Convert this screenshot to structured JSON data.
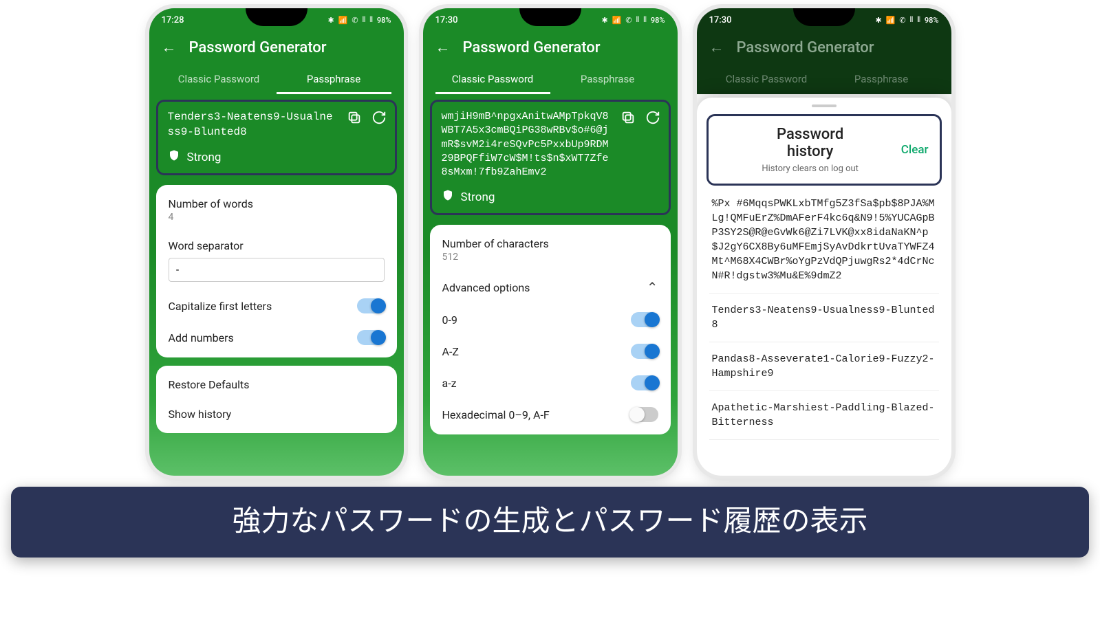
{
  "status": {
    "time1": "17:28",
    "time2": "17:30",
    "time3": "17:30",
    "battery": "98%",
    "icons": "✱ ✉ ⋯   ✱ 📶 ✆ 🔇 ⫴ ⫴"
  },
  "pageTitle": "Password Generator",
  "tabs": {
    "classic": "Classic Password",
    "passphrase": "Passphrase"
  },
  "phone1": {
    "output": "Tenders3-Neatens9-Usualness9-Blunted8",
    "strength": "Strong",
    "numWordsLabel": "Number of words",
    "numWordsValue": "4",
    "separatorLabel": "Word separator",
    "separatorValue": "-",
    "capLabel": "Capitalize first letters",
    "addNumLabel": "Add numbers",
    "restoreLabel": "Restore Defaults",
    "historyLabel": "Show history"
  },
  "phone2": {
    "output": "wmjiH9mB^npgxAnitwAMpTpkqV8WBT7A5x3cmBQiPG38wRBv$o#6@jmR$svM2i4reSQvPc5PxxbUp9RDM29BPQFfiW7cW$M!ts$n$xWT7Zfe8sMxm!7fb9ZahEmv2",
    "strength": "Strong",
    "numCharsLabel": "Number of characters",
    "numCharsValue": "512",
    "advLabel": "Advanced options",
    "opt1": "0-9",
    "opt2": "A-Z",
    "opt3": "a-z",
    "opt4": "Hexadecimal 0–9, A-F"
  },
  "phone3": {
    "historyTitle1": "Password",
    "historyTitle2": "history",
    "historySub": "History clears on log out",
    "clear": "Clear",
    "items": [
      "%Px\n#6MqqsPWKLxbTMfg5Z3fSa$pb$8PJA%MLg!QMFuErZ%DmAFerF4kc6q&N9!5%YUCAGpBP3SY2S@R@eGvWk6@Zi7LVK@xx8idaNaKN^p$J2gY6CX8By6uMFEmjSyAvDdkrtUvaTYWFZ4Mt^M68X4CWBr%oYgPzVdQPjuwgRs2*4dCrNcN#R!dgstw3%Mu&E%9dmZ2",
      "Tenders3-Neatens9-Usualness9-Blunted8",
      "Pandas8-Asseverate1-Calorie9-Fuzzy2-Hampshire9",
      "Apathetic-Marshiest-Paddling-Blazed-Bitterness"
    ]
  },
  "caption": "強力なパスワードの生成とパスワード履歴の表示"
}
